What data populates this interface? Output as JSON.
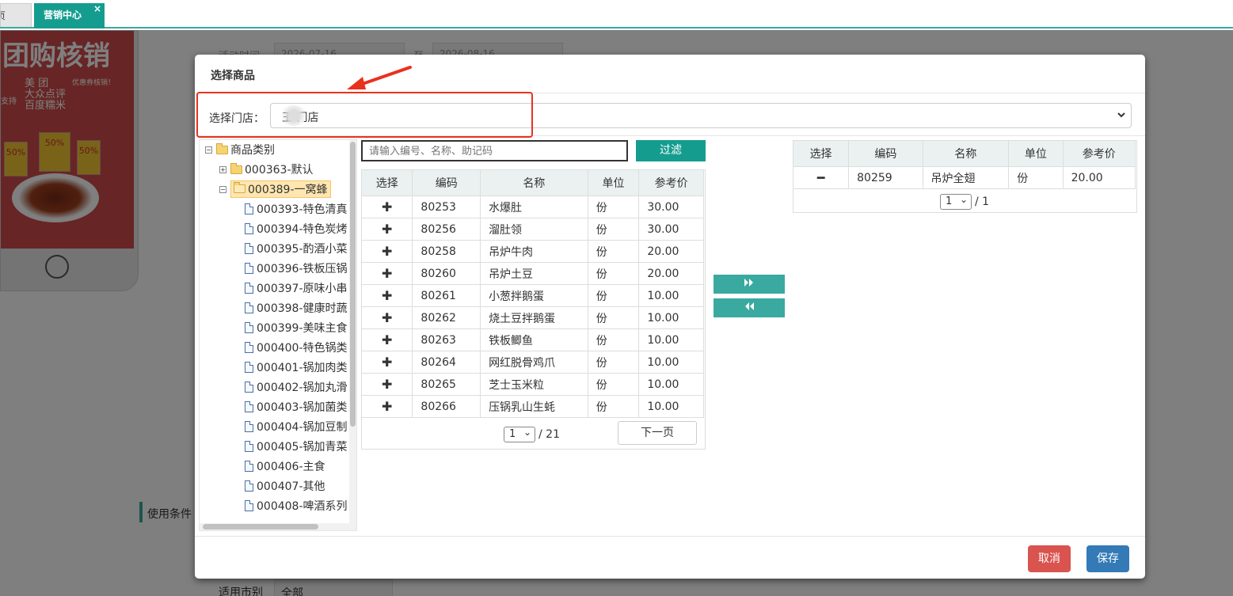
{
  "tabs": {
    "prev_label": "页",
    "active_label": "营销中心",
    "close_icon": "×"
  },
  "background": {
    "phone_title": "团购核销",
    "phone_sub": [
      "美  团",
      "大众点评",
      "百度糯米"
    ],
    "phone_side": "优惠券核销！",
    "phone_left": "支持",
    "coupons": [
      "50%",
      "50%",
      "50%"
    ],
    "field_time_label": "活动时间",
    "field_time_start": "2026-07-16",
    "field_time_to": "至",
    "field_time_end": "2026-08-16",
    "section_label": "使用条件",
    "market_label": "适用市别",
    "market_value": "全部"
  },
  "modal": {
    "title": "选择商品",
    "store_label": "选择门店：",
    "store_value": "王   门店",
    "filter_placeholder": "请输入编号、名称、助记码",
    "filter_button": "过滤",
    "move_right_icon": "double-right-icon",
    "move_left_icon": "double-left-icon",
    "cancel_label": "取消",
    "save_label": "保存"
  },
  "tree": {
    "root": "商品类别",
    "nodes": [
      {
        "label": "000363-默认",
        "type": "folder",
        "collapsed": true
      },
      {
        "label": "000389-一窝蜂",
        "type": "folder",
        "collapsed": false,
        "selected": true
      }
    ],
    "leaves": [
      "000393-特色清真",
      "000394-特色炭烤",
      "000395-酌酒小菜",
      "000396-铁板压锅",
      "000397-原味小串",
      "000398-健康时蔬",
      "000399-美味主食",
      "000400-特色锅类",
      "000401-锅加肉类",
      "000402-锅加丸滑",
      "000403-锅加菌类",
      "000404-锅加豆制",
      "000405-锅加青菜",
      "000406-主食",
      "000407-其他",
      "000408-啤酒系列"
    ]
  },
  "left_table": {
    "headers": [
      "选择",
      "编码",
      "名称",
      "单位",
      "参考价"
    ],
    "rows": [
      [
        "80253",
        "水爆肚",
        "份",
        "30.00"
      ],
      [
        "80256",
        "溜肚领",
        "份",
        "30.00"
      ],
      [
        "80258",
        "吊炉牛肉",
        "份",
        "20.00"
      ],
      [
        "80260",
        "吊炉土豆",
        "份",
        "20.00"
      ],
      [
        "80261",
        "小葱拌鹅蛋",
        "份",
        "10.00"
      ],
      [
        "80262",
        "烧土豆拌鹅蛋",
        "份",
        "10.00"
      ],
      [
        "80263",
        "铁板鲫鱼",
        "份",
        "10.00"
      ],
      [
        "80264",
        "网红脱骨鸡爪",
        "份",
        "10.00"
      ],
      [
        "80265",
        "芝士玉米粒",
        "份",
        "10.00"
      ],
      [
        "80266",
        "压锅乳山生蚝",
        "份",
        "10.00"
      ]
    ],
    "add_icon": "✚",
    "page_current": "1",
    "page_total": "/ 21",
    "next_label": "下一页"
  },
  "right_table": {
    "headers": [
      "选择",
      "编码",
      "名称",
      "单位",
      "参考价"
    ],
    "rows": [
      [
        "80259",
        "吊炉全翅",
        "份",
        "20.00"
      ]
    ],
    "remove_icon": "━",
    "page_current": "1",
    "page_total": "/ 1"
  },
  "colors": {
    "accent": "#149d8f",
    "cancel": "#d9534f",
    "save": "#337ab7",
    "highlight": "#e8321e"
  }
}
